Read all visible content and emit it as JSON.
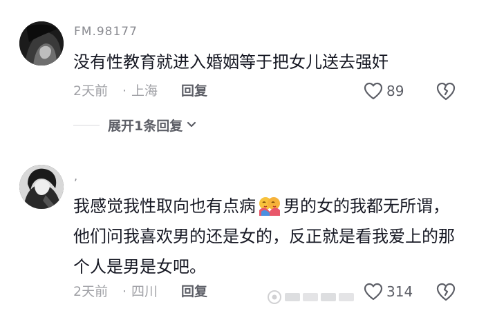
{
  "comments": [
    {
      "username": "FM.98177",
      "text": "没有性教育就进入婚姻等于把女儿送去强奸",
      "timestamp": "2天前",
      "separator": "·",
      "location": "上海",
      "reply_label": "回复",
      "like_count": "89",
      "expand_replies_label": "展开1条回复"
    },
    {
      "username": ",",
      "text_part1": "我感觉我性取向也有点病",
      "text_part2": "男的女的我都无所谓，他们问我喜欢男的还是女的，反正就是看我爱上的那个人是男是女吧。",
      "emoji_name": "hug-emoji",
      "timestamp": "2天前",
      "separator": "·",
      "location": "四川",
      "reply_label": "回复",
      "like_count": "314"
    }
  ],
  "icons": {
    "like": "heart-outline-icon",
    "dislike": "broken-heart-icon",
    "expand": "chevron-down-icon"
  },
  "colors": {
    "text_primary": "#161823",
    "text_secondary": "#a0a1a6",
    "action_text": "#5c5e66",
    "background": "#ffffff"
  }
}
